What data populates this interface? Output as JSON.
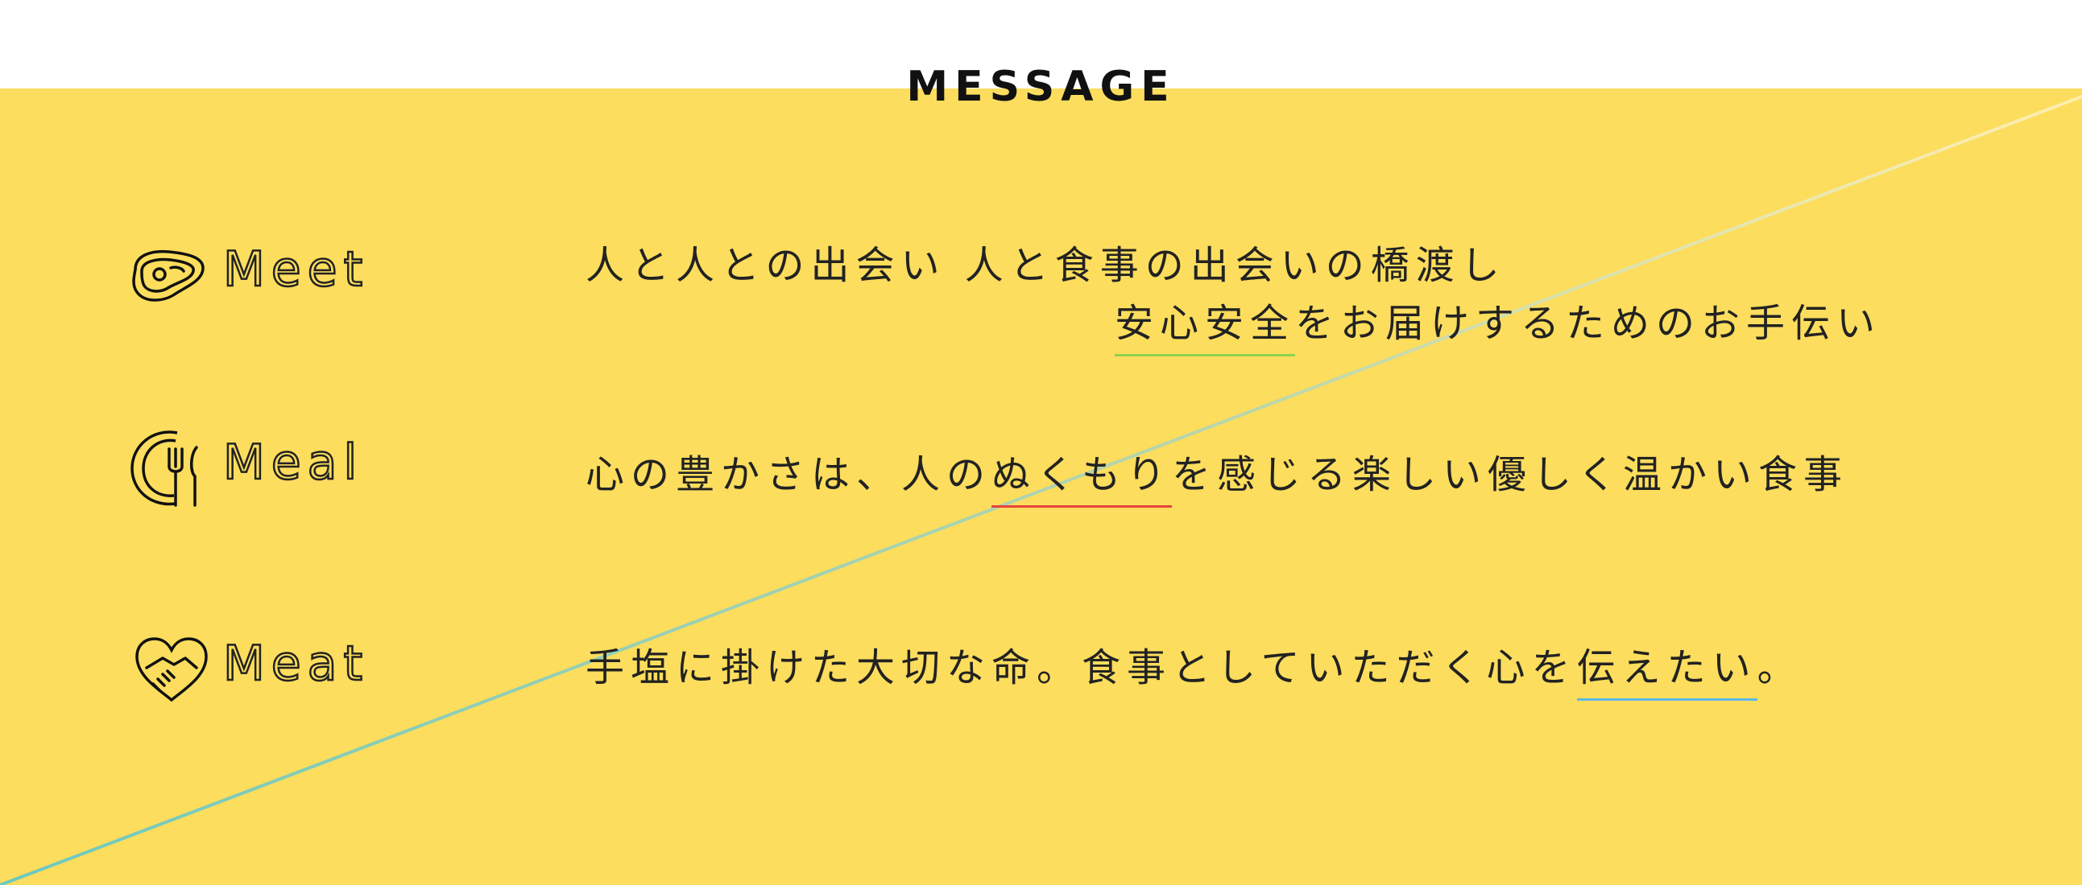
{
  "section": {
    "title": "MESSAGE"
  },
  "rows": [
    {
      "label": "Meet",
      "icon": "steak-icon",
      "line1": "人と人との出会い 人と食事の出会いの橋渡し",
      "line2_highlight": "安心安全",
      "line2_rest": "をお届けするためのお手伝い"
    },
    {
      "label": "Meal",
      "icon": "plate-fork-knife-icon",
      "text_before": "心の豊かさは、人の",
      "highlight": "ぬくもり",
      "text_after": "を感じる楽しい優しく温かい食事"
    },
    {
      "label": "Meat",
      "icon": "handshake-heart-icon",
      "text_before": "手塩に掛けた大切な命。食事としていただく心を",
      "highlight": "伝えたい",
      "text_after": "。"
    }
  ],
  "colors": {
    "background_yellow": "#fcdd5d",
    "highlight_green": "#8fd14a",
    "highlight_red": "#e8433c",
    "highlight_blue": "#5bb8e6"
  }
}
